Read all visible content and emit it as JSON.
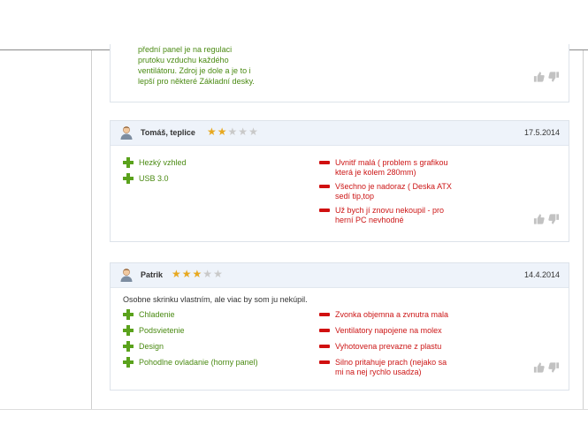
{
  "previous_review": {
    "lines": [
      "přední panel je na regulaci",
      "prutoku vzduchu každého",
      "ventilátoru. Zdroj je dole a je to i",
      "lepší pro některé Základní desky."
    ]
  },
  "reviews": [
    {
      "name": "Tomáš, teplice",
      "rating": 2,
      "max_rating": 5,
      "date": "17.5.2014",
      "pros": [
        "Hezký vzhled",
        "USB 3.0"
      ],
      "cons": [
        [
          "Uvnitř malá ( problem s grafikou",
          "která je kolem 280mm)"
        ],
        [
          "Všechno je nadoraz ( Deska ATX",
          "sedí tip,top"
        ],
        [
          "Už bych jí znovu nekoupil - pro",
          "herní PC nevhodné"
        ]
      ]
    },
    {
      "name": "Patrik",
      "rating": 3,
      "max_rating": 5,
      "date": "14.4.2014",
      "comment": "Osobne skrinku vlastním, ale viac by som ju nekúpil.",
      "pros": [
        "Chladenie",
        "Podsvietenie",
        "Design",
        "Pohodlne ovladanie (horny panel)"
      ],
      "cons": [
        [
          "Zvonka objemna a zvnutra mala"
        ],
        [
          "Ventilatory napojene na molex"
        ],
        [
          "Vyhotovena prevazne z plastu"
        ],
        [
          "Silno pritahuje prach (nejako sa",
          "mi na nej rychlo usadza)"
        ]
      ]
    }
  ],
  "icons": {
    "plus": "plus-icon",
    "minus": "minus-icon",
    "thumb_up": "thumb-up-icon",
    "thumb_down": "thumb-down-icon",
    "avatar": "user-avatar-icon",
    "star": "star-icon"
  },
  "colors": {
    "pros_text": "#4a8a12",
    "cons_text": "#cc1616",
    "header_bg": "#eef3fa",
    "star_filled": "#e7a820",
    "star_empty": "#c9c9c9"
  }
}
